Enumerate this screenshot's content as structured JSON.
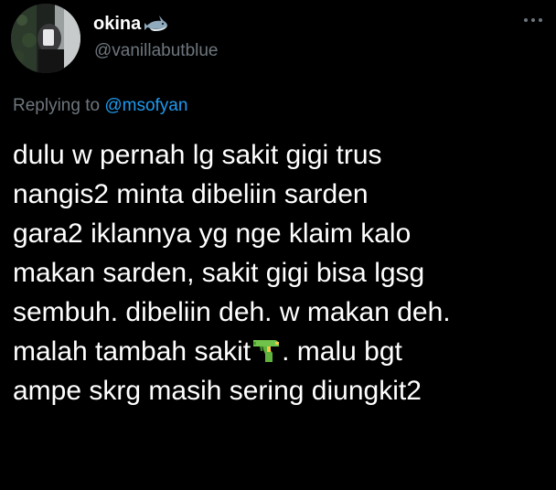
{
  "author": {
    "display_name": "okina",
    "handle": "@vanillabutblue",
    "badge_icon": "shark-emoji-icon",
    "avatar": "profile-photo"
  },
  "reply": {
    "prefix": "Replying to",
    "mention": "@msofyan"
  },
  "tweet": {
    "lines": [
      "dulu w pernah lg sakit gigi trus",
      "nangis2 minta dibeliin sarden",
      "gara2 iklannya yg nge klaim kalo",
      "makan sarden, sakit gigi bisa lgsg",
      "sembuh. dibeliin deh. w makan deh."
    ],
    "line6_before": "malah tambah sakit",
    "line6_after": ". malu bgt",
    "line7": "ampe skrg masih sering diungkit2",
    "inline_emoji_icon": "water-pistol-icon"
  },
  "menu": {
    "icon": "more-horizontal-icon"
  },
  "colors": {
    "background": "#000000",
    "text": "#ffffff",
    "secondary": "#6e767d",
    "link": "#1d9bf0"
  }
}
